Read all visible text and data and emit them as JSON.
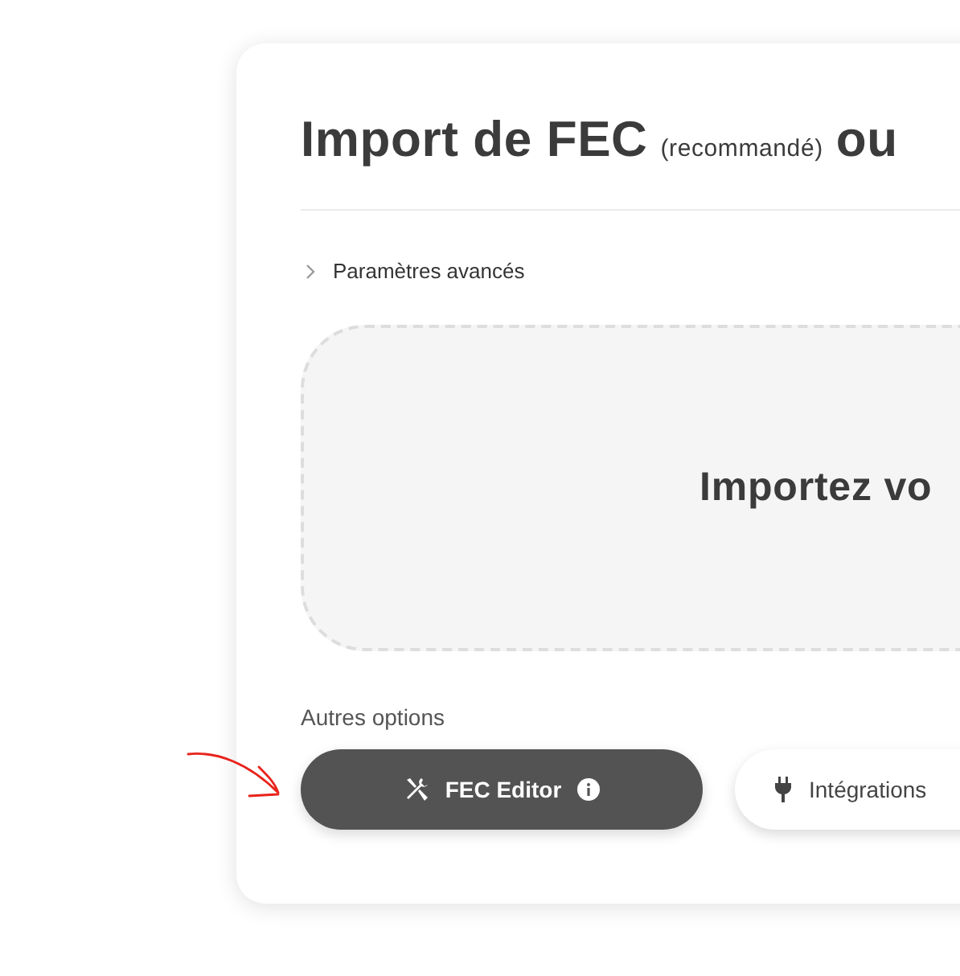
{
  "title": {
    "main": "Import de FEC",
    "note": "(recommandé)",
    "tail": "ou"
  },
  "advanced": {
    "label": "Paramètres avancés",
    "expanded": false
  },
  "dropzone": {
    "heading": "Importez vo"
  },
  "other_options": {
    "label": "Autres options",
    "buttons": [
      {
        "label": "FEC Editor",
        "kind": "tools",
        "selected": true,
        "info": true
      },
      {
        "label": "Intégrations",
        "kind": "plug",
        "selected": false,
        "info": false
      }
    ]
  }
}
